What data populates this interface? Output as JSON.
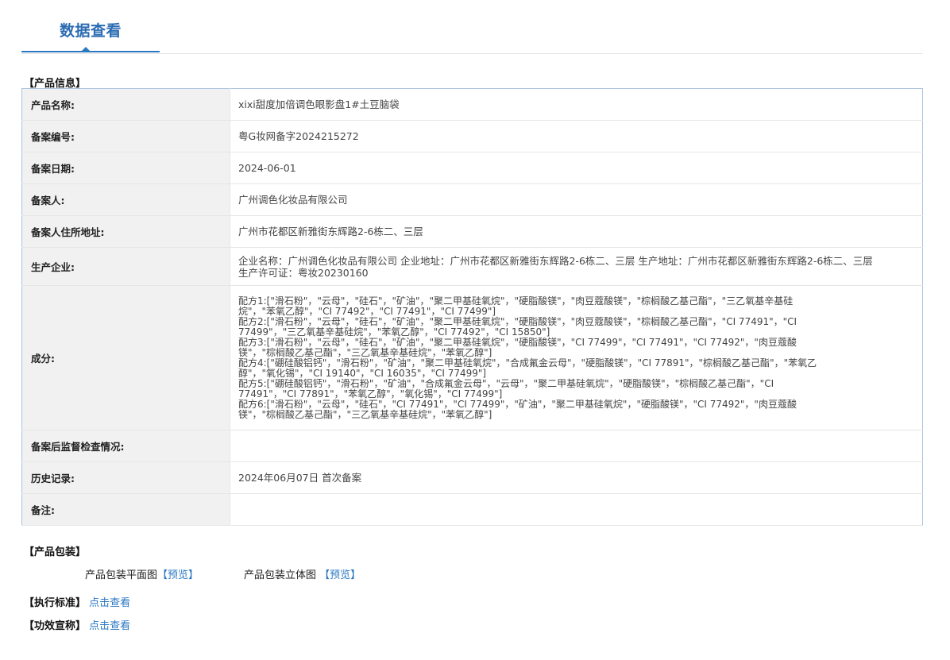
{
  "header": {
    "title": "数据查看"
  },
  "sections": {
    "product_info": "【产品信息】",
    "product_packaging": "【产品包装】"
  },
  "info": {
    "name_label": "产品名称:",
    "name_value": "xixi甜度加倍调色眼影盘1#土豆脑袋",
    "record_no_label": "备案编号:",
    "record_no_value": "粤G妆网备字2024215272",
    "record_date_label": "备案日期:",
    "record_date_value": "2024-06-01",
    "registrant_label": "备案人:",
    "registrant_value": "广州调色化妆品有限公司",
    "address_label": "备案人住所地址:",
    "address_value": "广州市花都区新雅街东辉路2-6栋二、三层",
    "producer_label": "生产企业:",
    "producer_value": "企业名称：广州调色化妆品有限公司 企业地址：广州市花都区新雅街东辉路2-6栋二、三层 生产地址：广州市花都区新雅街东辉路2-6栋二、三层 生产许可证：粤妆20230160",
    "ingredients_label": "成分:",
    "ingredients_lines": [
      "配方1:[\"滑石粉\"，\"云母\"，\"硅石\"，\"矿油\"，\"聚二甲基硅氧烷\"，\"硬脂酸镁\"，\"肉豆蔻酸镁\"，\"棕榈酸乙基己酯\"，\"三乙氧基辛基硅",
      "烷\"，\"苯氧乙醇\"，\"CI 77492\"，\"CI 77491\"，\"CI 77499\"]",
      "配方2:[\"滑石粉\"，\"云母\"，\"硅石\"，\"矿油\"，\"聚二甲基硅氧烷\"，\"硬脂酸镁\"，\"肉豆蔻酸镁\"，\"棕榈酸乙基己酯\"，\"CI 77491\"，\"CI",
      "77499\"，\"三乙氧基辛基硅烷\"，\"苯氧乙醇\"，\"CI 77492\"，\"CI 15850\"]",
      "配方3:[\"滑石粉\"，\"云母\"，\"硅石\"，\"矿油\"，\"聚二甲基硅氧烷\"，\"硬脂酸镁\"，\"CI 77499\"，\"CI 77491\"，\"CI 77492\"，\"肉豆蔻酸",
      "镁\"，\"棕榈酸乙基己酯\"，\"三乙氧基辛基硅烷\"，\"苯氧乙醇\"]",
      "配方4:[\"硼硅酸铝钙\"，\"滑石粉\"，\"矿油\"，\"聚二甲基硅氧烷\"，\"合成氟金云母\"，\"硬脂酸镁\"，\"CI 77891\"，\"棕榈酸乙基己酯\"，\"苯氧乙",
      "醇\"，\"氧化锡\"，\"CI 19140\"，\"CI 16035\"，\"CI 77499\"]",
      "配方5:[\"硼硅酸铝钙\"，\"滑石粉\"，\"矿油\"，\"合成氟金云母\"，\"云母\"，\"聚二甲基硅氧烷\"，\"硬脂酸镁\"，\"棕榈酸乙基己酯\"，\"CI",
      "77491\"，\"CI 77891\"，\"苯氧乙醇\"，\"氧化锡\"，\"CI 77499\"]",
      "配方6:[\"滑石粉\"，\"云母\"，\"硅石\"，\"CI 77491\"，\"CI 77499\"，\"矿油\"，\"聚二甲基硅氧烷\"，\"硬脂酸镁\"，\"CI 77492\"，\"肉豆蔻酸",
      "镁\"，\"棕榈酸乙基己酯\"，\"三乙氧基辛基硅烷\"，\"苯氧乙醇\"]"
    ],
    "post_inspection_label": "备案后监督检查情况:",
    "post_inspection_value": "",
    "history_label": "历史记录:",
    "history_value": "2024年06月07日 首次备案",
    "remarks_label": "备注:",
    "remarks_value": ""
  },
  "packaging": {
    "flat_label": "产品包装平面图",
    "flat_link": "【预览】",
    "stereo_label": "产品包装立体图",
    "stereo_link": "【预览】"
  },
  "standards": {
    "label": "【执行标准】",
    "link": "点击查看"
  },
  "efficacy": {
    "label": "【功效宣称】",
    "link": "点击查看"
  },
  "colors": {
    "accent": "#2b78c2",
    "title": "#2b6cb2",
    "border": "#a9c3dd",
    "key_bg": "#f1f1f1"
  }
}
